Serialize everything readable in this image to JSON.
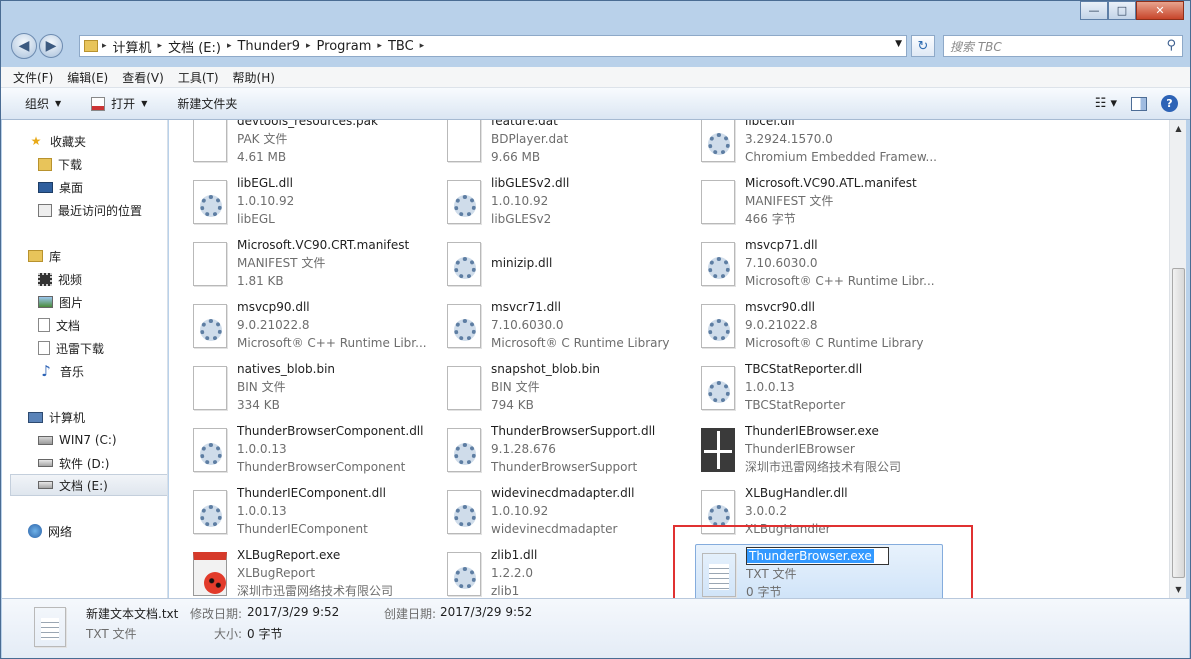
{
  "window": {
    "minimize": "—",
    "maximize": "□",
    "close": "✕"
  },
  "nav": {
    "back": "◀",
    "forward": "▶"
  },
  "address": {
    "root_arrow": "▸",
    "crumbs": [
      "计算机",
      "文档 (E:)",
      "Thunder9",
      "Program",
      "TBC"
    ],
    "search_placeholder": "搜索 TBC"
  },
  "menu": [
    "文件(F)",
    "编辑(E)",
    "查看(V)",
    "工具(T)",
    "帮助(H)"
  ],
  "toolbar": {
    "organize": "组织",
    "open": "打开",
    "new_folder": "新建文件夹"
  },
  "navpane": {
    "favorites": "收藏夹",
    "downloads": "下载",
    "desktop": "桌面",
    "recent": "最近访问的位置",
    "libraries": "库",
    "videos": "视频",
    "pictures": "图片",
    "documents": "文档",
    "xunlei": "迅雷下载",
    "music": "音乐",
    "computer": "计算机",
    "drive_c": "WIN7 (C:)",
    "drive_d": "软件 (D:)",
    "drive_e": "文档 (E:)",
    "network": "网络"
  },
  "files": [
    {
      "n": "devtools_resources.pak",
      "s1": "PAK 文件",
      "s2": "4.61 MB",
      "icon": "doc"
    },
    {
      "n": "feature.dat",
      "s1": "BDPlayer.dat",
      "s2": "9.66 MB",
      "icon": "doc"
    },
    {
      "n": "libcef.dll",
      "s1": "3.2924.1570.0",
      "s2": "Chromium Embedded Framew...",
      "icon": "dll"
    },
    {
      "n": "libEGL.dll",
      "s1": "1.0.10.92",
      "s2": "libEGL",
      "icon": "dll"
    },
    {
      "n": "libGLESv2.dll",
      "s1": "1.0.10.92",
      "s2": "libGLESv2",
      "icon": "dll"
    },
    {
      "n": "Microsoft.VC90.ATL.manifest",
      "s1": "MANIFEST 文件",
      "s2": "466 字节",
      "icon": "doc"
    },
    {
      "n": "Microsoft.VC90.CRT.manifest",
      "s1": "MANIFEST 文件",
      "s2": "1.81 KB",
      "icon": "doc"
    },
    {
      "n": "minizip.dll",
      "s1": "",
      "s2": "",
      "icon": "dll"
    },
    {
      "n": "msvcp71.dll",
      "s1": "7.10.6030.0",
      "s2": "Microsoft® C++ Runtime Libr...",
      "icon": "dll"
    },
    {
      "n": "msvcp90.dll",
      "s1": "9.0.21022.8",
      "s2": "Microsoft® C++ Runtime Libr...",
      "icon": "dll"
    },
    {
      "n": "msvcr71.dll",
      "s1": "7.10.6030.0",
      "s2": "Microsoft® C Runtime Library",
      "icon": "dll"
    },
    {
      "n": "msvcr90.dll",
      "s1": "9.0.21022.8",
      "s2": "Microsoft® C Runtime Library",
      "icon": "dll"
    },
    {
      "n": "natives_blob.bin",
      "s1": "BIN 文件",
      "s2": "334 KB",
      "icon": "doc"
    },
    {
      "n": "snapshot_blob.bin",
      "s1": "BIN 文件",
      "s2": "794 KB",
      "icon": "doc"
    },
    {
      "n": "TBCStatReporter.dll",
      "s1": "1.0.0.13",
      "s2": "TBCStatReporter",
      "icon": "dll"
    },
    {
      "n": "ThunderBrowserComponent.dll",
      "s1": "1.0.0.13",
      "s2": "ThunderBrowserComponent",
      "icon": "dll"
    },
    {
      "n": "ThunderBrowserSupport.dll",
      "s1": "9.1.28.676",
      "s2": "ThunderBrowserSupport",
      "icon": "dll"
    },
    {
      "n": "ThunderIEBrowser.exe",
      "s1": "ThunderIEBrowser",
      "s2": "深圳市迅雷网络技术有限公司",
      "icon": "gift"
    },
    {
      "n": "ThunderIEComponent.dll",
      "s1": "1.0.0.13",
      "s2": "ThunderIEComponent",
      "icon": "dll"
    },
    {
      "n": "widevinecdmadapter.dll",
      "s1": "1.0.10.92",
      "s2": "widevinecdmadapter",
      "icon": "dll"
    },
    {
      "n": "XLBugHandler.dll",
      "s1": "3.0.0.2",
      "s2": "XLBugHandler",
      "icon": "dll"
    },
    {
      "n": "XLBugReport.exe",
      "s1": "XLBugReport",
      "s2": "深圳市迅雷网络技术有限公司",
      "icon": "bug"
    },
    {
      "n": "zlib1.dll",
      "s1": "1.2.2.0",
      "s2": "zlib1",
      "icon": "dll"
    },
    {
      "n": "ThunderBrowser.exe",
      "s1": "TXT 文件",
      "s2": "0 字节",
      "icon": "txt"
    }
  ],
  "details": {
    "name": "新建文本文档.txt",
    "type": "TXT 文件",
    "modified_label": "修改日期:",
    "modified": "2017/3/29 9:52",
    "created_label": "创建日期:",
    "created": "2017/3/29 9:52",
    "size_label": "大小:",
    "size": "0 字节"
  },
  "colors": {
    "selection": "#cfe3f8",
    "highlight_box": "#e03131"
  }
}
